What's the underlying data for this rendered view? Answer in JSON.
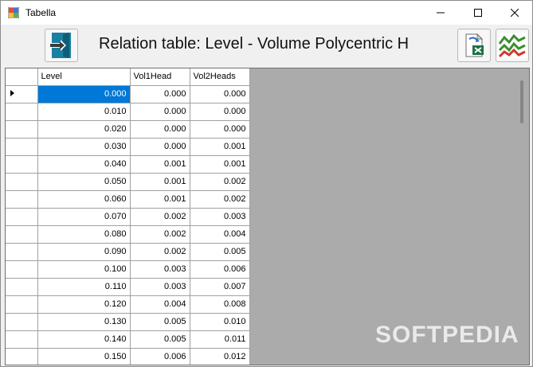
{
  "window": {
    "title": "Tabella"
  },
  "toolbar": {
    "heading": "Relation table: Level - Volume Polycentric H"
  },
  "icons": {
    "app": "table-app-icon",
    "exit": "exit-door-icon",
    "excel": "excel-export-icon",
    "chart": "line-chart-icon"
  },
  "colors": {
    "selection": "#0078d7",
    "grid_background": "#ababab"
  },
  "table": {
    "columns": [
      "Level",
      "Vol1Head",
      "Vol2Heads"
    ],
    "rows": [
      [
        "0.000",
        "0.000",
        "0.000"
      ],
      [
        "0.010",
        "0.000",
        "0.000"
      ],
      [
        "0.020",
        "0.000",
        "0.000"
      ],
      [
        "0.030",
        "0.000",
        "0.001"
      ],
      [
        "0.040",
        "0.001",
        "0.001"
      ],
      [
        "0.050",
        "0.001",
        "0.002"
      ],
      [
        "0.060",
        "0.001",
        "0.002"
      ],
      [
        "0.070",
        "0.002",
        "0.003"
      ],
      [
        "0.080",
        "0.002",
        "0.004"
      ],
      [
        "0.090",
        "0.002",
        "0.005"
      ],
      [
        "0.100",
        "0.003",
        "0.006"
      ],
      [
        "0.110",
        "0.003",
        "0.007"
      ],
      [
        "0.120",
        "0.004",
        "0.008"
      ],
      [
        "0.130",
        "0.005",
        "0.010"
      ],
      [
        "0.140",
        "0.005",
        "0.011"
      ],
      [
        "0.150",
        "0.006",
        "0.012"
      ]
    ]
  },
  "watermark": "SOFTPEDIA"
}
